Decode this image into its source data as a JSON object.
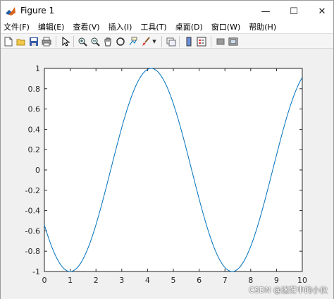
{
  "window": {
    "title": "Figure 1",
    "controls": {
      "minimize": "—",
      "maximize": "☐",
      "close": "✕"
    }
  },
  "menu": {
    "items": [
      "文件(F)",
      "编辑(E)",
      "查看(V)",
      "插入(I)",
      "工具(T)",
      "桌面(D)",
      "窗口(W)",
      "帮助(H)"
    ]
  },
  "toolbar": {
    "buttons": [
      "new-figure-icon",
      "open-file-icon",
      "save-icon",
      "print-icon",
      "pointer-icon",
      "zoom-in-icon",
      "zoom-out-icon",
      "pan-icon",
      "rotate-3d-icon",
      "data-cursor-icon",
      "brush-icon",
      "link-plot-icon",
      "colorbar-icon",
      "legend-icon",
      "hide-plot-tools-icon",
      "show-plot-tools-icon"
    ]
  },
  "chart_data": {
    "type": "line",
    "function_desc": "y = cos(x - 4.14)",
    "x_range": [
      0,
      10
    ],
    "xlim": [
      0,
      10
    ],
    "ylim": [
      -1,
      1
    ],
    "xticks": [
      "0",
      "1",
      "2",
      "3",
      "4",
      "5",
      "6",
      "7",
      "8",
      "9",
      "10"
    ],
    "yticks": [
      "1",
      "0.8",
      "0.6",
      "0.4",
      "0.2",
      "0",
      "-0.2",
      "-0.4",
      "-0.6",
      "-0.8",
      "-1"
    ],
    "series": [
      {
        "color": "#0072bd",
        "x": [
          0,
          0.5,
          1,
          1.5,
          2,
          2.5,
          3,
          3.5,
          4,
          4.14,
          4.5,
          5,
          5.5,
          6,
          6.5,
          7,
          7.28,
          7.5,
          8,
          8.5,
          9,
          9.5,
          10
        ],
        "y": [
          -0.55,
          -0.9,
          -1.0,
          -0.87,
          -0.54,
          -0.08,
          0.42,
          0.8,
          0.99,
          1.0,
          0.94,
          0.65,
          0.21,
          -0.28,
          -0.71,
          -0.96,
          -1.0,
          -0.98,
          -0.74,
          -0.34,
          0.15,
          0.61,
          0.91
        ]
      }
    ],
    "grid": false
  },
  "watermark": "CSDN @迷茫中的小伙"
}
